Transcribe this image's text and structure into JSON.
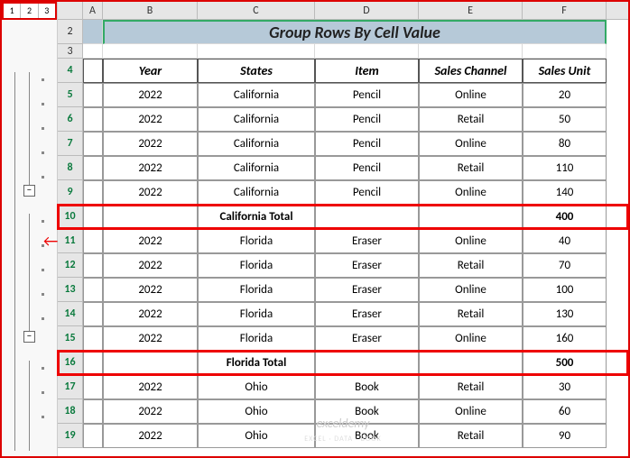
{
  "outline": {
    "level1": "1",
    "level2": "2",
    "level3": "3",
    "collapse": "−"
  },
  "columns": [
    "A",
    "B",
    "C",
    "D",
    "E",
    "F"
  ],
  "title": "Group Rows By Cell Value",
  "headers": {
    "year": "Year",
    "states": "States",
    "item": "Item",
    "channel": "Sales Channel",
    "unit": "Sales Unit"
  },
  "rows": [
    {
      "num": "2",
      "type": "title"
    },
    {
      "num": "3",
      "type": "blank"
    },
    {
      "num": "4",
      "type": "header"
    },
    {
      "num": "5",
      "type": "data",
      "year": "2022",
      "state": "California",
      "item": "Pencil",
      "chan": "Online",
      "unit": "20"
    },
    {
      "num": "6",
      "type": "data",
      "year": "2022",
      "state": "California",
      "item": "Pencil",
      "chan": "Retail",
      "unit": "50"
    },
    {
      "num": "7",
      "type": "data",
      "year": "2022",
      "state": "California",
      "item": "Pencil",
      "chan": "Online",
      "unit": "80"
    },
    {
      "num": "8",
      "type": "data",
      "year": "2022",
      "state": "California",
      "item": "Pencil",
      "chan": "Retail",
      "unit": "110"
    },
    {
      "num": "9",
      "type": "data",
      "year": "2022",
      "state": "California",
      "item": "Pencil",
      "chan": "Online",
      "unit": "140"
    },
    {
      "num": "10",
      "type": "total",
      "label": "California Total",
      "unit": "400"
    },
    {
      "num": "11",
      "type": "data",
      "year": "2022",
      "state": "Florida",
      "item": "Eraser",
      "chan": "Online",
      "unit": "40"
    },
    {
      "num": "12",
      "type": "data",
      "year": "2022",
      "state": "Florida",
      "item": "Eraser",
      "chan": "Retail",
      "unit": "70"
    },
    {
      "num": "13",
      "type": "data",
      "year": "2022",
      "state": "Florida",
      "item": "Eraser",
      "chan": "Online",
      "unit": "100"
    },
    {
      "num": "14",
      "type": "data",
      "year": "2022",
      "state": "Florida",
      "item": "Eraser",
      "chan": "Retail",
      "unit": "130"
    },
    {
      "num": "15",
      "type": "data",
      "year": "2022",
      "state": "Florida",
      "item": "Eraser",
      "chan": "Online",
      "unit": "160"
    },
    {
      "num": "16",
      "type": "total",
      "label": "Florida Total",
      "unit": "500"
    },
    {
      "num": "17",
      "type": "data",
      "year": "2022",
      "state": "Ohio",
      "item": "Book",
      "chan": "Retail",
      "unit": "30"
    },
    {
      "num": "18",
      "type": "data",
      "year": "2022",
      "state": "Ohio",
      "item": "Book",
      "chan": "Online",
      "unit": "60"
    },
    {
      "num": "19",
      "type": "data",
      "year": "2022",
      "state": "Ohio",
      "item": "Book",
      "chan": "Retail",
      "unit": "90"
    }
  ],
  "watermark": {
    "main": "exceldemy",
    "sub": "EXCEL · DATA · BOOK"
  }
}
